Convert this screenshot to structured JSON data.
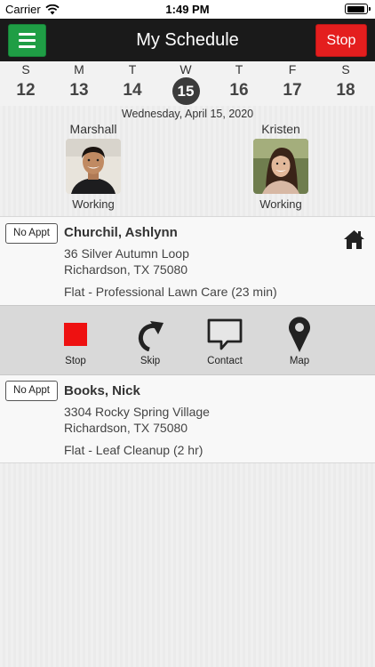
{
  "status_bar": {
    "carrier": "Carrier",
    "time": "1:49 PM",
    "battery_level": 0.95
  },
  "header": {
    "title": "My Schedule",
    "stop_label": "Stop"
  },
  "week": {
    "days": [
      {
        "letter": "S",
        "number": "12"
      },
      {
        "letter": "M",
        "number": "13"
      },
      {
        "letter": "T",
        "number": "14"
      },
      {
        "letter": "W",
        "number": "15",
        "selected": true
      },
      {
        "letter": "T",
        "number": "16"
      },
      {
        "letter": "F",
        "number": "17"
      },
      {
        "letter": "S",
        "number": "18"
      }
    ],
    "selected_date": "Wednesday, April 15, 2020"
  },
  "workers": [
    {
      "name": "Marshall",
      "status": "Working"
    },
    {
      "name": "Kristen",
      "status": "Working"
    }
  ],
  "appointments": [
    {
      "badge": "No Appt",
      "customer": "Churchil, Ashlynn",
      "address_line1": "36 Silver Autumn Loop",
      "address_line2": "Richardson, TX 75080",
      "service": "Flat - Professional Lawn Care (23 min)",
      "icon": "home-icon"
    },
    {
      "badge": "No Appt",
      "customer": "Books, Nick",
      "address_line1": "3304 Rocky Spring Village",
      "address_line2": "Richardson, TX 75080",
      "service": "Flat - Leaf Cleanup (2 hr)"
    }
  ],
  "actions": [
    {
      "label": "Stop",
      "icon": "stop-square-icon"
    },
    {
      "label": "Skip",
      "icon": "redo-arrow-icon"
    },
    {
      "label": "Contact",
      "icon": "speech-bubble-icon"
    },
    {
      "label": "Map",
      "icon": "map-pin-icon"
    }
  ],
  "colors": {
    "header_bg": "#1a1a1a",
    "menu_green": "#1f9e45",
    "stop_red": "#e41e1e",
    "selected_day": "#3b3b3b",
    "action_bar": "#d9d9d9"
  }
}
